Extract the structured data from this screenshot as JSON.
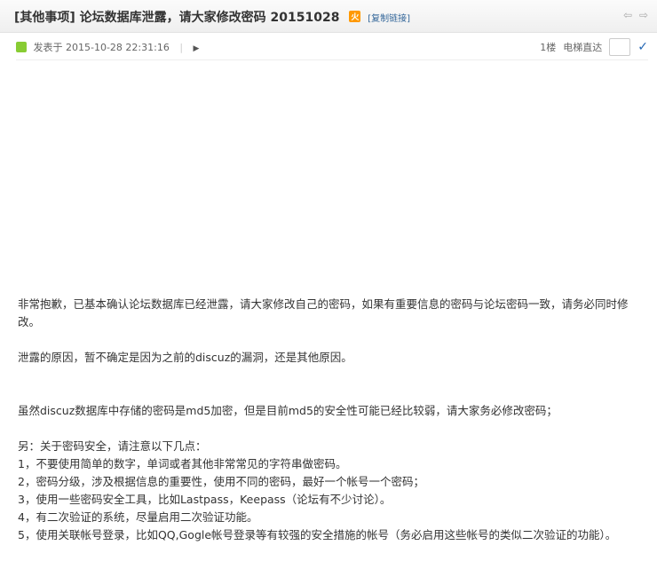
{
  "header": {
    "category": "[其他事项]",
    "title": "论坛数据库泄露，请大家修改密码 20151028",
    "hot_badge": "火",
    "copy_link": "[复制链接]",
    "prev": "⇦",
    "next": "⇨"
  },
  "post": {
    "posted_label": "发表于",
    "datetime": "2015-10-28 22:31:16",
    "floor": "1楼",
    "jump_label": "电梯直达",
    "jump_value": ""
  },
  "content": [
    "非常抱歉，已基本确认论坛数据库已经泄露，请大家修改自己的密码，如果有重要信息的密码与论坛密码一致，请务必同时修改。",
    "泄露的原因，暂不确定是因为之前的discuz的漏洞，还是其他原因。",
    "虽然discuz数据库中存储的密码是md5加密，但是目前md5的安全性可能已经比较弱，请大家务必修改密码；",
    "另：关于密码安全，请注意以下几点：",
    "1，不要使用简单的数字，单词或者其他非常常见的字符串做密码。",
    "2，密码分级，涉及根据信息的重要性，使用不同的密码，最好一个帐号一个密码；",
    "3，使用一些密码安全工具，比如Lastpass，Keepass（论坛有不少讨论）。",
    "4，有二次验证的系统，尽量启用二次验证功能。",
    "5，使用关联帐号登录，比如QQ,Gogle帐号登录等有较强的安全措施的帐号（务必启用这些帐号的类似二次验证的功能）。"
  ]
}
